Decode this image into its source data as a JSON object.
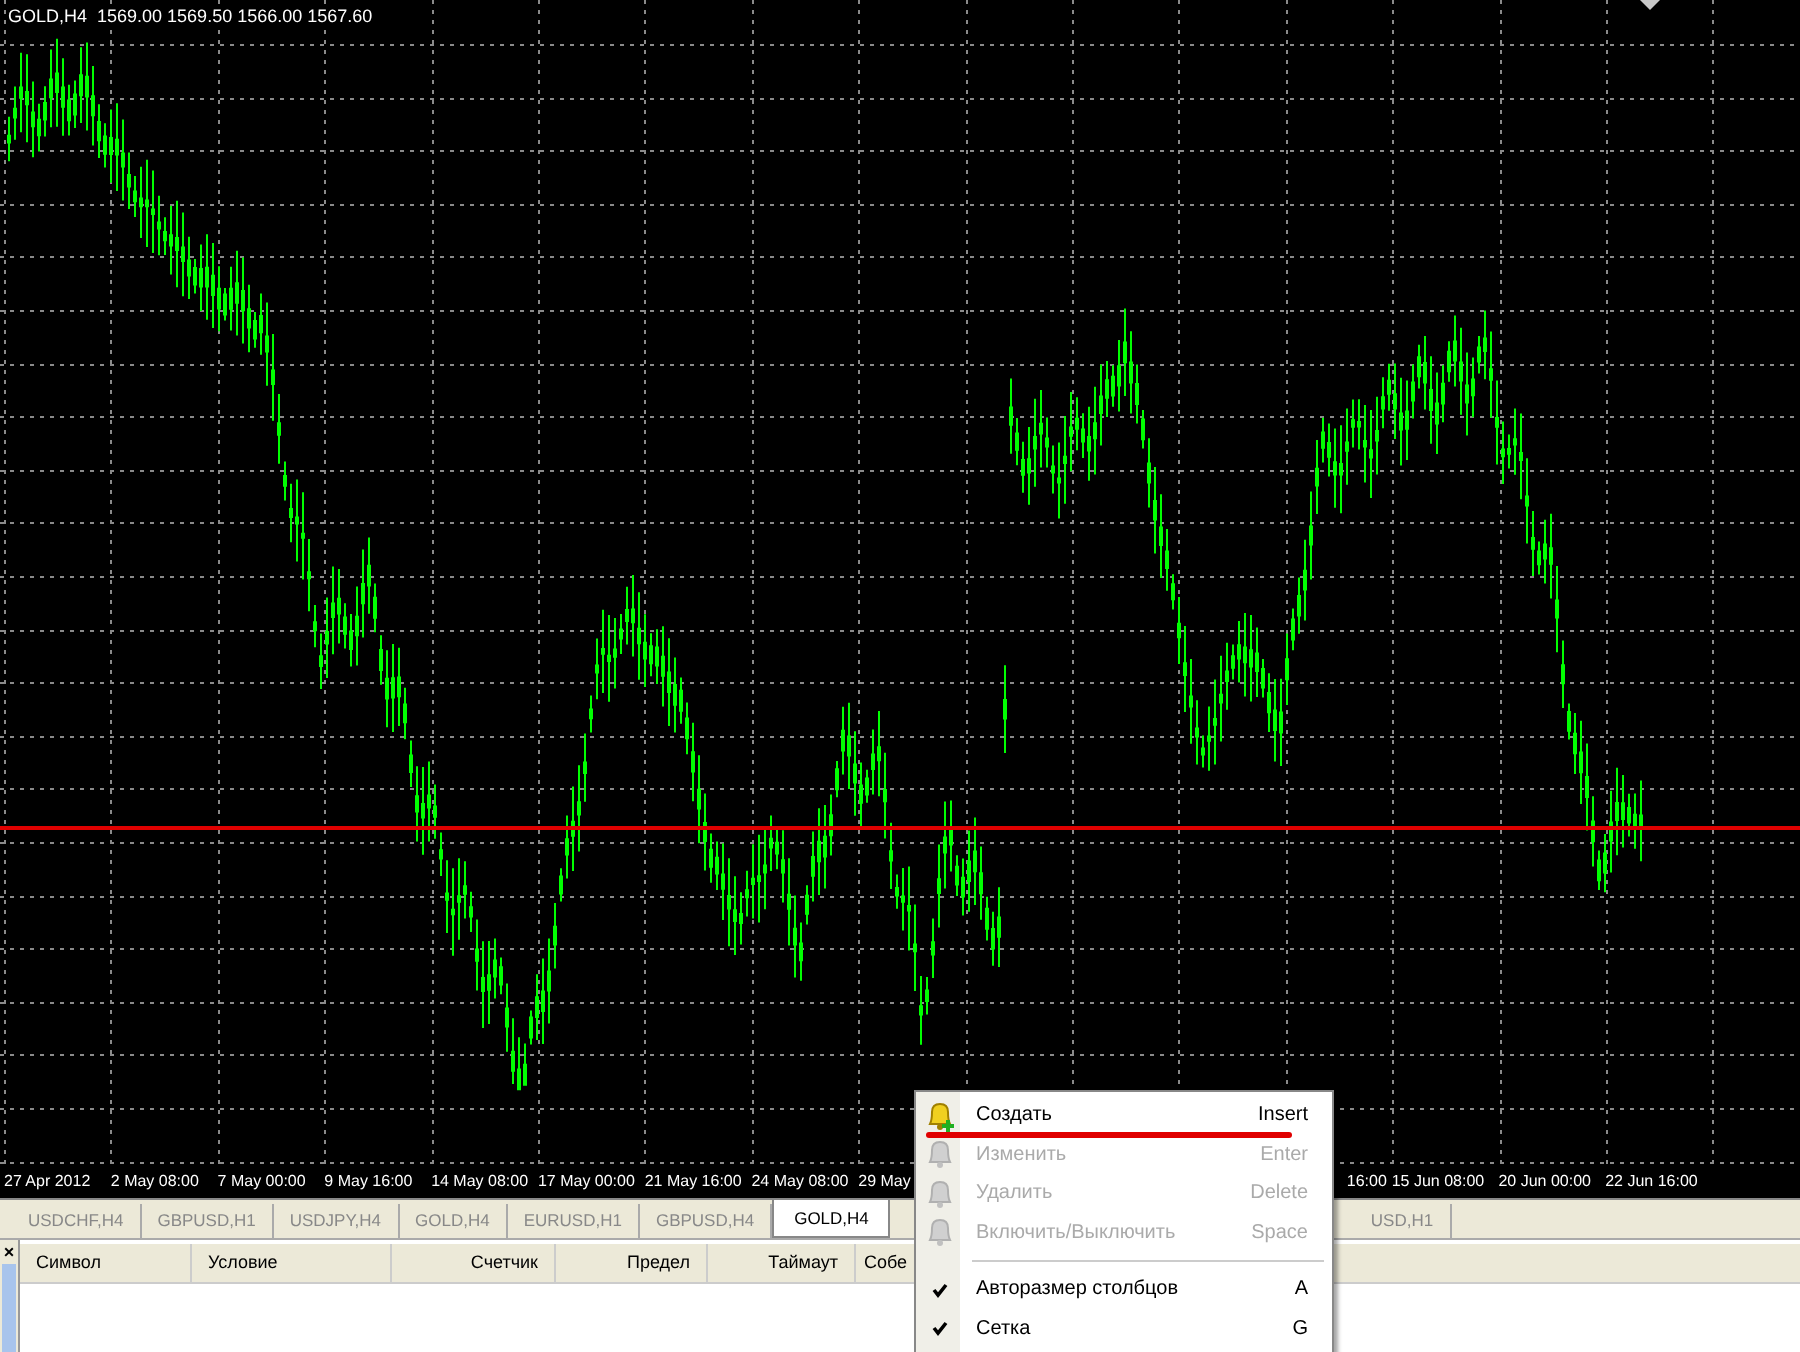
{
  "chart": {
    "header": "GOLD,H4  1569.00 1569.50 1566.00 1567.60"
  },
  "time_axis": {
    "labels_left": [
      "27 Apr 2012",
      "2 May 08:00",
      "7 May 00:00",
      "9 May 16:00",
      "14 May 08:00",
      "17 May 00:00",
      "21 May 16:00",
      "24 May 08:00",
      "29 May"
    ],
    "labels_right": [
      "16:00",
      "15 Jun 08:00",
      "20 Jun 00:00",
      "22 Jun 16:00"
    ]
  },
  "chart_tabs": [
    {
      "label": "USDCHF,H4",
      "selected": false
    },
    {
      "label": "GBPUSD,H1",
      "selected": false
    },
    {
      "label": "USDJPY,H4",
      "selected": false
    },
    {
      "label": "GOLD,H4",
      "selected": false
    },
    {
      "label": "EURUSD,H1",
      "selected": false
    },
    {
      "label": "GBPUSD,H4",
      "selected": false
    },
    {
      "label": "GOLD,H4",
      "selected": true
    }
  ],
  "chart_tabs_right": [
    {
      "label": "USD,H1",
      "selected": false
    }
  ],
  "alerts_table": {
    "close": "×",
    "columns": [
      "Символ",
      "Условие",
      "Счетчик",
      "Предел",
      "Таймаут",
      "Собе"
    ]
  },
  "context_menu": {
    "items": [
      {
        "kind": "action",
        "label": "Создать",
        "shortcut": "Insert",
        "disabled": false,
        "underlined": true
      },
      {
        "kind": "action",
        "label": "Изменить",
        "shortcut": "Enter",
        "disabled": true,
        "underlined": false
      },
      {
        "kind": "action",
        "label": "Удалить",
        "shortcut": "Delete",
        "disabled": true,
        "underlined": false
      },
      {
        "kind": "action",
        "label": "Включить/Выключить",
        "shortcut": "Space",
        "disabled": true,
        "underlined": false
      },
      {
        "kind": "separator"
      },
      {
        "kind": "check",
        "label": "Авторазмер столбцов",
        "shortcut": "A",
        "checked": true
      },
      {
        "kind": "check",
        "label": "Сетка",
        "shortcut": "G",
        "checked": true
      }
    ]
  }
}
